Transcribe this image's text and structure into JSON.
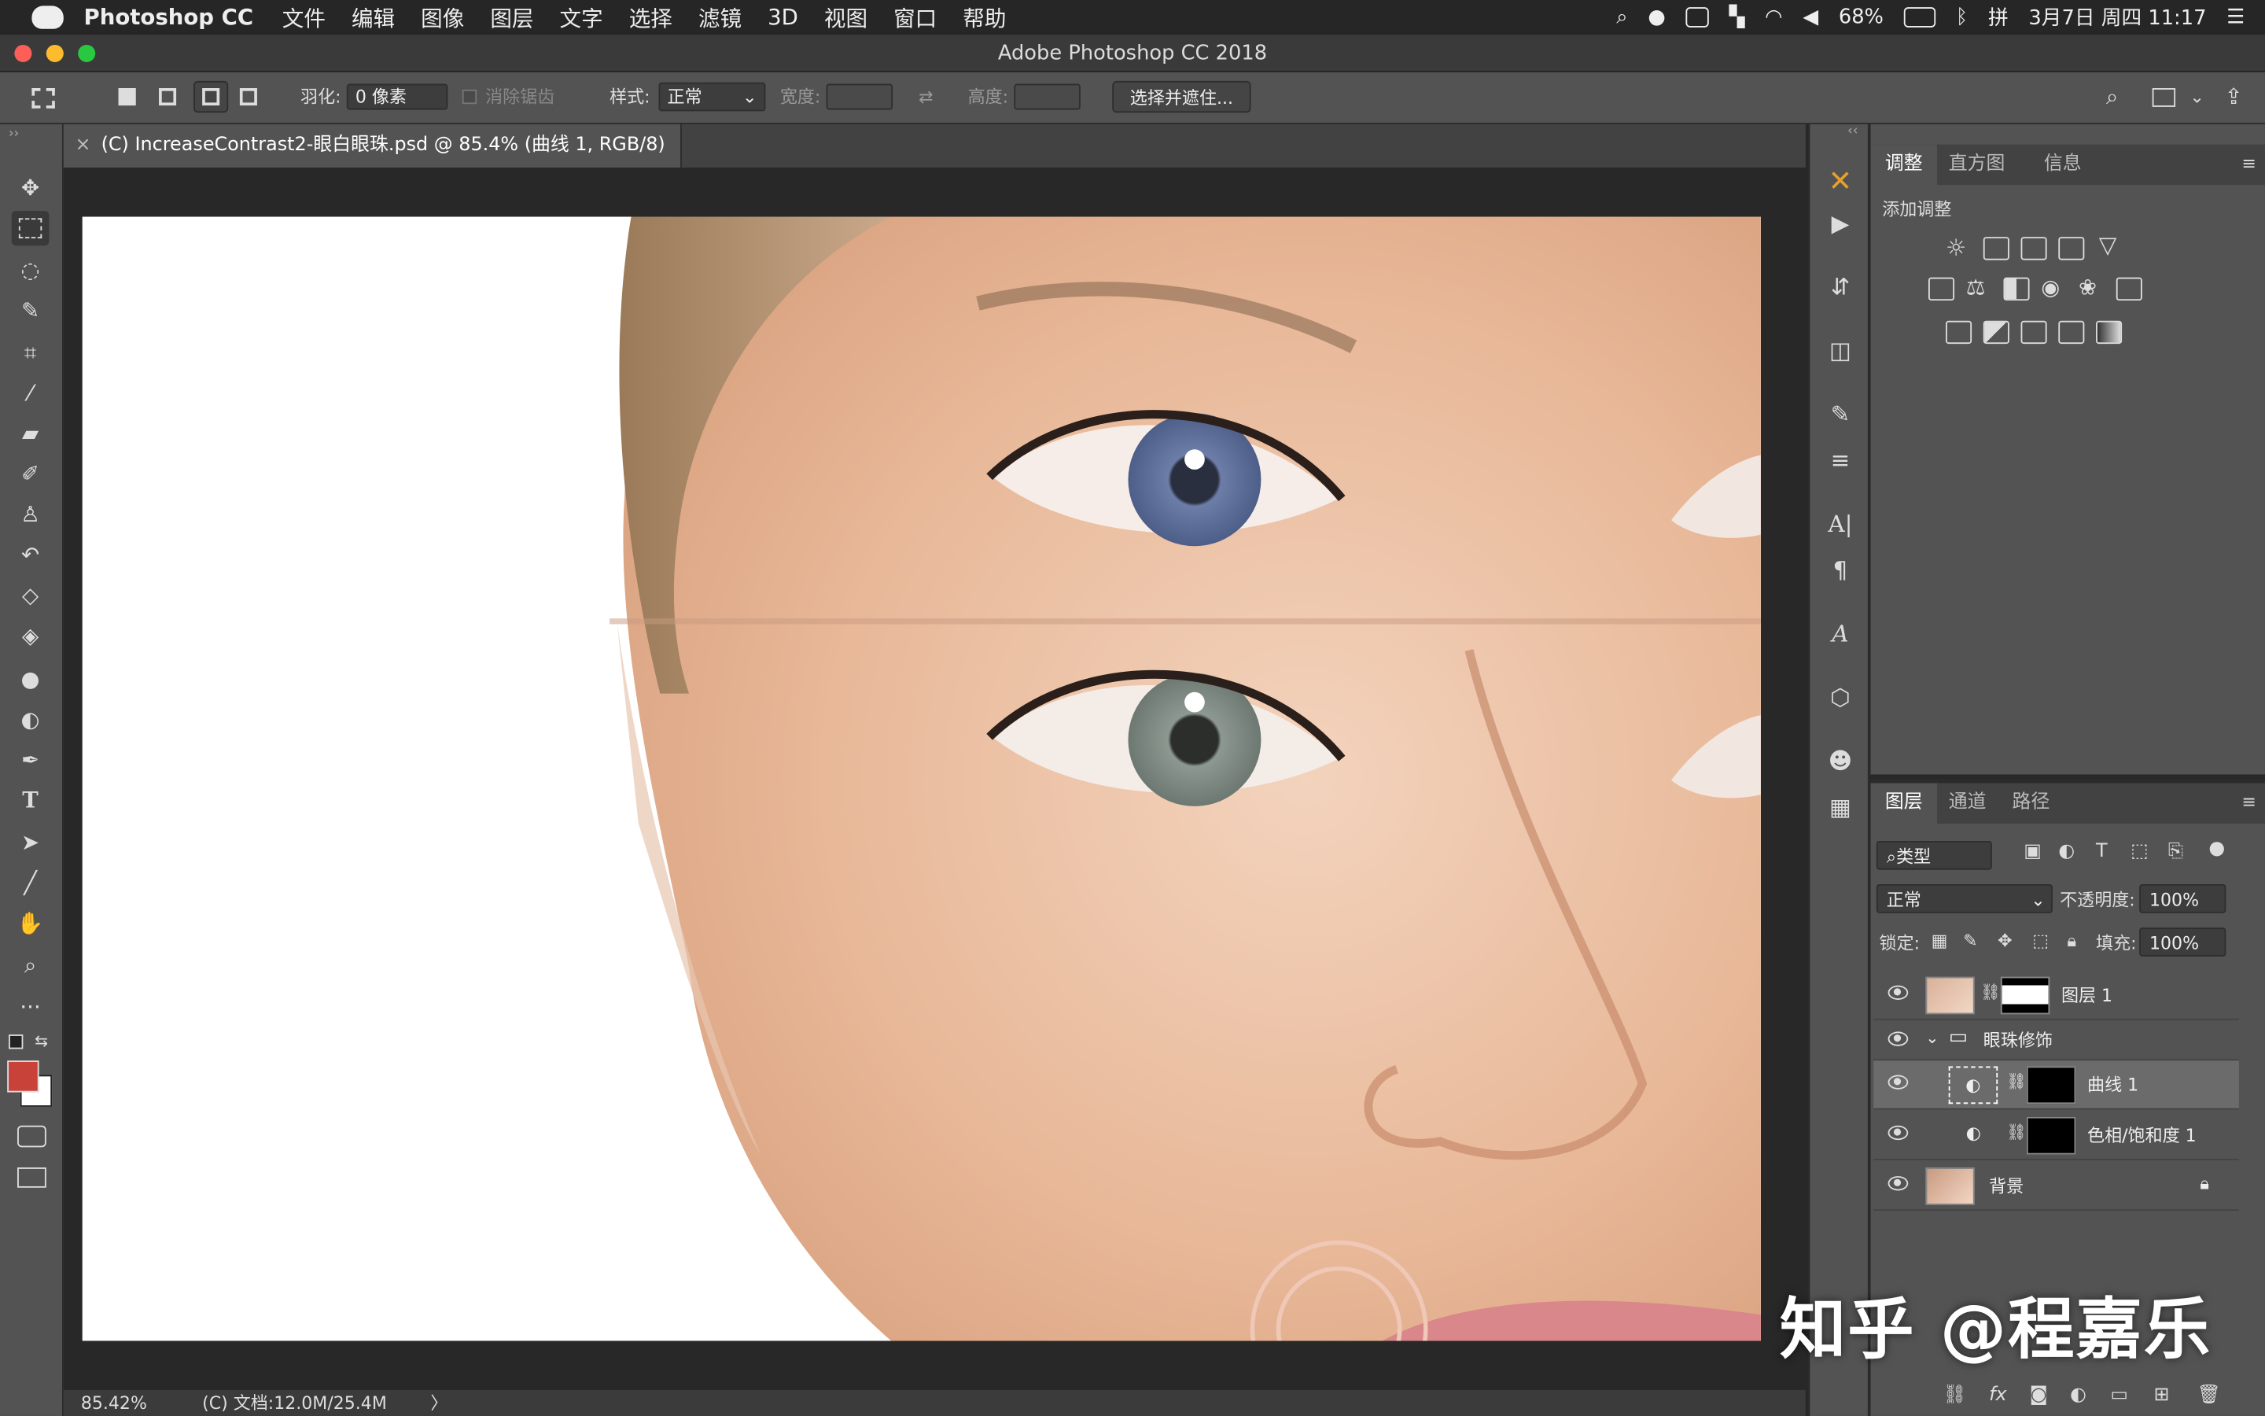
{
  "menubar": {
    "app": "Photoshop CC",
    "items": [
      "文件",
      "编辑",
      "图像",
      "图层",
      "文字",
      "选择",
      "滤镜",
      "3D",
      "视图",
      "窗口",
      "帮助"
    ],
    "battery": "68%",
    "clock": "3月7日 周四 11:17"
  },
  "titlebar": {
    "title": "Adobe Photoshop CC 2018"
  },
  "options": {
    "feather_label": "羽化:",
    "feather_value": "0 像素",
    "antialias_label": "消除锯齿",
    "style_label": "样式:",
    "style_value": "正常",
    "width_label": "宽度:",
    "height_label": "高度:",
    "select_mask": "选择并遮住..."
  },
  "document": {
    "tab": "(C) IncreaseContrast2-眼白眼珠.psd @ 85.4% (曲线 1, RGB/8) *",
    "close": "×"
  },
  "status": {
    "zoom": "85.42%",
    "doc": "(C) 文档:12.0M/25.4M",
    "arrow": "〉"
  },
  "adjustments": {
    "tabs": [
      "调整",
      "直方图",
      "信息"
    ],
    "add_label": "添加调整"
  },
  "layers_panel": {
    "tabs": [
      "图层",
      "通道",
      "路径"
    ],
    "filter_kind": "类型",
    "blend_mode": "正常",
    "opacity_label": "不透明度:",
    "opacity_value": "100%",
    "lock_label": "锁定:",
    "fill_label": "填充:",
    "fill_value": "100%",
    "layers": [
      {
        "name": "图层 1"
      },
      {
        "name": "眼珠修饰"
      },
      {
        "name": "曲线 1"
      },
      {
        "name": "色相/饱和度 1"
      },
      {
        "name": "背景"
      }
    ]
  },
  "watermark": "知乎 @程嘉乐",
  "colors": {
    "foreground": "#c8423a",
    "background": "#ffffff",
    "panel": "#535353",
    "accent": "#e8a02a"
  }
}
